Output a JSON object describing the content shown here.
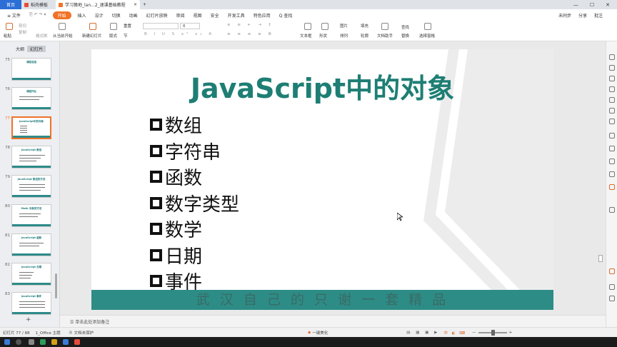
{
  "titlebar": {
    "tabs": [
      {
        "label": "首页"
      },
      {
        "label": "稻壳模板"
      },
      {
        "label": "学习猿地_lan...2_速课基础教程"
      }
    ],
    "new_tab": "+"
  },
  "menu": {
    "file": "≡ 文件",
    "items": [
      "开始",
      "插入",
      "设计",
      "切换",
      "动画",
      "幻灯片放映",
      "审阅",
      "视图",
      "安全",
      "开发工具",
      "特色应用"
    ],
    "search": "Q 查找",
    "right": [
      "未同步",
      "分享",
      "批注"
    ]
  },
  "ribbon": {
    "paste": "粘贴",
    "cut": "剪切",
    "copy": "复制",
    "format_painter": "格式刷",
    "from_current": "从当前开始",
    "new_slide": "新建幻灯片",
    "layout": "版式",
    "section": "节",
    "reset": "重置",
    "font_size": "0",
    "textbox": "文本框",
    "shape": "形状",
    "arrange": "排列",
    "picture": "图片",
    "fill": "填充",
    "outline": "轮廓",
    "find": "查找",
    "replace": "替换",
    "doc_assistant": "文档助手",
    "select_pane": "选择窗格"
  },
  "leftpanel": {
    "tab_outline": "大纲",
    "tab_slides": "幻灯片",
    "slides": [
      {
        "num": "75",
        "title": "课程总结"
      },
      {
        "num": "76",
        "title": "课程作业"
      },
      {
        "num": "77",
        "title": "JavaScript中的对象"
      },
      {
        "num": "78",
        "title": "JavaScript 数组"
      },
      {
        "num": "79",
        "title": "JavaScript 数组的方法"
      },
      {
        "num": "80",
        "title": "Math 对象的方法"
      },
      {
        "num": "81",
        "title": "JavaScript 函数"
      },
      {
        "num": "82",
        "title": "JavaScript 日期"
      },
      {
        "num": "83",
        "title": "JavaScript 事件"
      }
    ],
    "add": "+"
  },
  "slide": {
    "title": "JavaScript中的对象",
    "bullets": [
      "数组",
      "字符串",
      "函数",
      "数字类型",
      "数学",
      "日期",
      "事件"
    ],
    "slogan": "武 汉 自 己 的 只 谢 一 套 精 品"
  },
  "notes": {
    "placeholder": "单击此处添加备注"
  },
  "status": {
    "slide_info": "幻灯片 77 / 88",
    "theme": "1_Office 主题",
    "doc_status": "文档未保护",
    "beautify": "一键美化",
    "zoom": "—"
  },
  "colors": {
    "accent": "#f07328",
    "title_teal": "#1e7e74",
    "band_teal": "#2d8c86",
    "home_tab": "#2b6fd6"
  }
}
